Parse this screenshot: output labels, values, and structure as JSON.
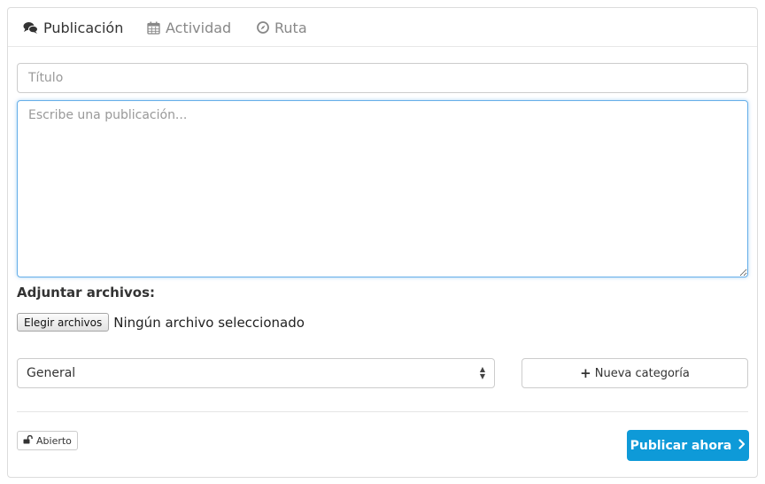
{
  "tabs": [
    {
      "label": "Publicación",
      "icon": "comments-icon",
      "active": true
    },
    {
      "label": "Actividad",
      "icon": "calendar-icon",
      "active": false
    },
    {
      "label": "Ruta",
      "icon": "compass-icon",
      "active": false
    }
  ],
  "form": {
    "title_placeholder": "Título",
    "title_value": "",
    "body_placeholder": "Escribe una publicación...",
    "body_value": "",
    "attach_label": "Adjuntar archivos:",
    "file_button_label": "Elegir archivos",
    "file_status": "Ningún archivo seleccionado",
    "category_selected": "General",
    "new_category_label": "Nueva categoría",
    "privacy_label": "Abierto",
    "privacy_icon": "unlock-icon",
    "publish_label": "Publicar ahora"
  },
  "colors": {
    "accent": "#0e9ad8",
    "focus_border": "#66afe9",
    "border": "#cccccc",
    "muted_text": "#888888"
  }
}
